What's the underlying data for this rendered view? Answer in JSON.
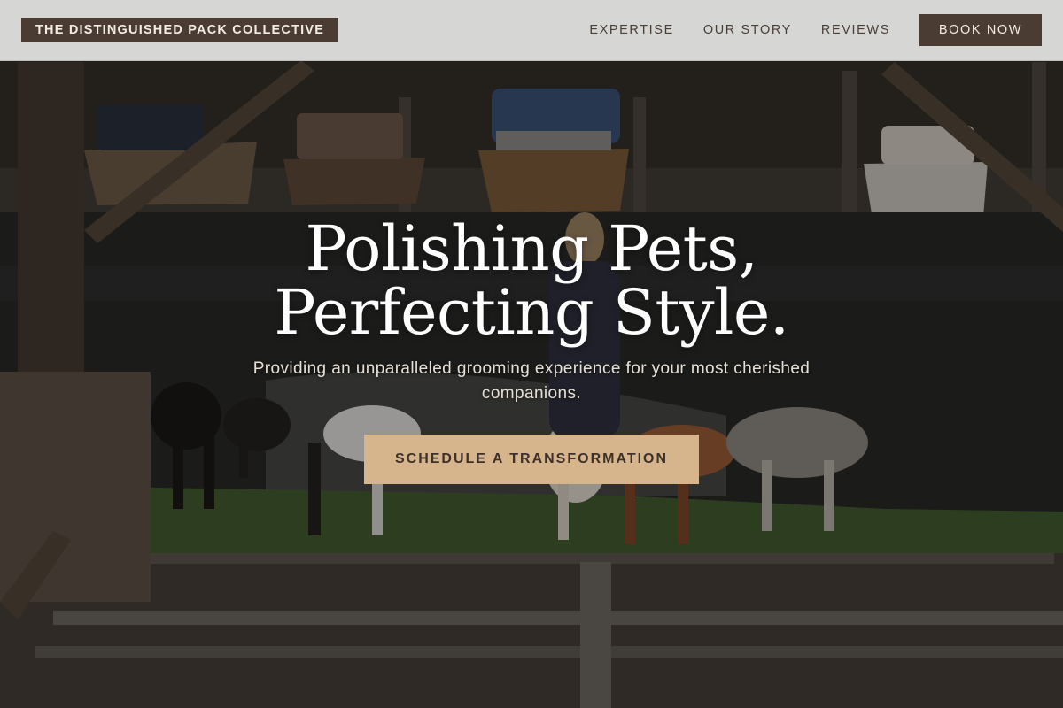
{
  "header": {
    "brand": "THE DISTINGUISHED PACK COLLECTIVE",
    "nav": [
      {
        "label": "EXPERTISE"
      },
      {
        "label": "OUR STORY"
      },
      {
        "label": "REVIEWS"
      }
    ],
    "book_label": "BOOK NOW"
  },
  "hero": {
    "title_line1": "Polishing Pets,",
    "title_line2": "Perfecting Style.",
    "subtitle": "Providing an unparalleled grooming experience for your most cherished companions.",
    "cta_label": "SCHEDULE A TRANSFORMATION",
    "background_image": "dogs-by-harbor-photo"
  },
  "colors": {
    "header_bg": "#d6d6d5",
    "brand_bg": "#4a3c33",
    "accent": "#d6b48c",
    "text_dark": "#4a3e36"
  }
}
